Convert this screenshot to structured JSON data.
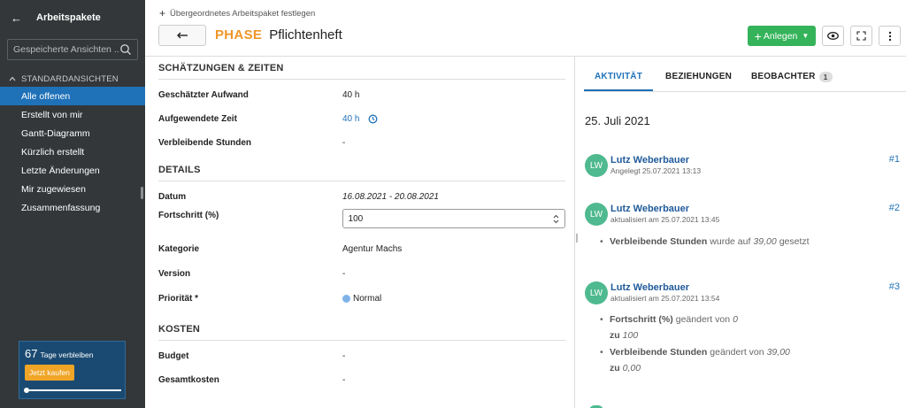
{
  "sidebar": {
    "title": "Arbeitspakete",
    "search_placeholder": "Gespeicherte Ansichten ...",
    "section_label": "STANDARDANSICHTEN",
    "items": [
      {
        "label": "Alle offenen",
        "active": true
      },
      {
        "label": "Erstellt von mir"
      },
      {
        "label": "Gantt-Diagramm"
      },
      {
        "label": "Kürzlich erstellt"
      },
      {
        "label": "Letzte Änderungen"
      },
      {
        "label": "Mir zugewiesen"
      },
      {
        "label": "Zusammenfassung"
      }
    ],
    "trial": {
      "days": "67",
      "days_label": "Tage verbleiben",
      "buy_label": "Jetzt kaufen"
    }
  },
  "header": {
    "breadcrumb": "Übergeordnetes Arbeitspaket festlegen",
    "type": "PHASE",
    "subject": "Pflichtenheft",
    "create_label": "Anlegen"
  },
  "estimates": {
    "title": "SCHÄTZUNGEN & ZEITEN",
    "rows": [
      {
        "label": "Geschätzter Aufwand",
        "value": "40 h"
      },
      {
        "label": "Aufgewendete Zeit",
        "value": "40 h"
      },
      {
        "label": "Verbleibende Stunden",
        "value": "-"
      }
    ]
  },
  "details": {
    "title": "DETAILS",
    "date_label": "Datum",
    "date_value": "16.08.2021 - 20.08.2021",
    "progress_label": "Fortschritt (%)",
    "progress_value": "100",
    "category_label": "Kategorie",
    "category_value": "Agentur Machs",
    "version_label": "Version",
    "version_value": "-",
    "priority_label": "Priorität *",
    "priority_value": "Normal"
  },
  "costs": {
    "title": "KOSTEN",
    "rows": [
      {
        "label": "Budget",
        "value": "-"
      },
      {
        "label": "Gesamtkosten",
        "value": "-"
      }
    ]
  },
  "activity_panel": {
    "tabs": [
      {
        "label": "AKTIVITÄT",
        "active": true
      },
      {
        "label": "BEZIEHUNGEN"
      },
      {
        "label": "BEOBACHTER",
        "badge": "1"
      }
    ],
    "date": "25. Juli 2021",
    "entries": [
      {
        "initials": "LW",
        "user": "Lutz Weberbauer",
        "meta": "Angelegt 25.07.2021 13:13",
        "num": "#1"
      },
      {
        "initials": "LW",
        "user": "Lutz Weberbauer",
        "meta": "aktualisiert am 25.07.2021 13:45",
        "num": "#2",
        "change1": {
          "field": "Verbleibende Stunden",
          "text": "wurde auf",
          "value": "39,00",
          "suffix": "gesetzt"
        }
      },
      {
        "initials": "LW",
        "user": "Lutz Weberbauer",
        "meta": "aktualisiert am 25.07.2021 13:54",
        "num": "#3",
        "change1": {
          "field": "Fortschritt (%)",
          "text": "geändert von",
          "from": "0",
          "to_label": "zu",
          "to": "100"
        },
        "change2": {
          "field": "Verbleibende Stunden",
          "text": "geändert von",
          "from": "39,00",
          "to_label": "zu",
          "to": "0,00"
        }
      }
    ]
  },
  "colors": {
    "accent": "#1f71b8",
    "phase": "#f0952a",
    "create": "#35b35a",
    "sidebar": "#333739"
  }
}
